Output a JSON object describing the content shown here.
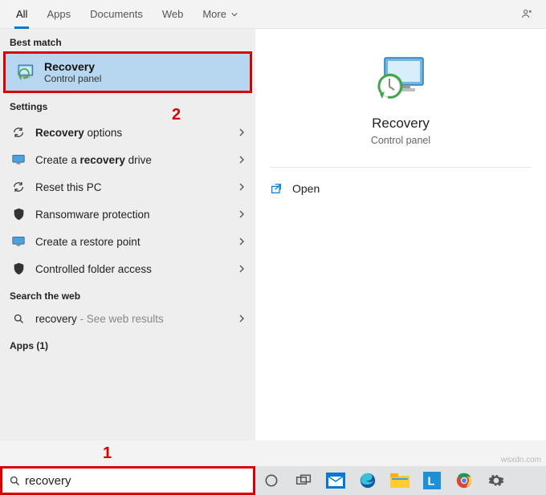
{
  "tabs": {
    "all": "All",
    "apps": "Apps",
    "documents": "Documents",
    "web": "Web",
    "more": "More"
  },
  "sections": {
    "best_match": "Best match",
    "settings": "Settings",
    "search_web": "Search the web",
    "apps_count": "Apps (1)"
  },
  "best": {
    "title": "Recovery",
    "subtitle": "Control panel"
  },
  "settings_items": {
    "r0_pre": "Recovery",
    "r0_post": " options",
    "r1_pre": "Create a ",
    "r1_bold": "recovery",
    "r1_post": " drive",
    "r2": "Reset this PC",
    "r3": "Ransomware protection",
    "r4": "Create a restore point",
    "r5": "Controlled folder access"
  },
  "web": {
    "term": "recovery",
    "suffix": " - See web results"
  },
  "preview": {
    "title": "Recovery",
    "subtitle": "Control panel",
    "open": "Open"
  },
  "search": {
    "value": "recovery"
  },
  "annotations": {
    "one": "1",
    "two": "2"
  },
  "watermark": "wsxdn.com"
}
